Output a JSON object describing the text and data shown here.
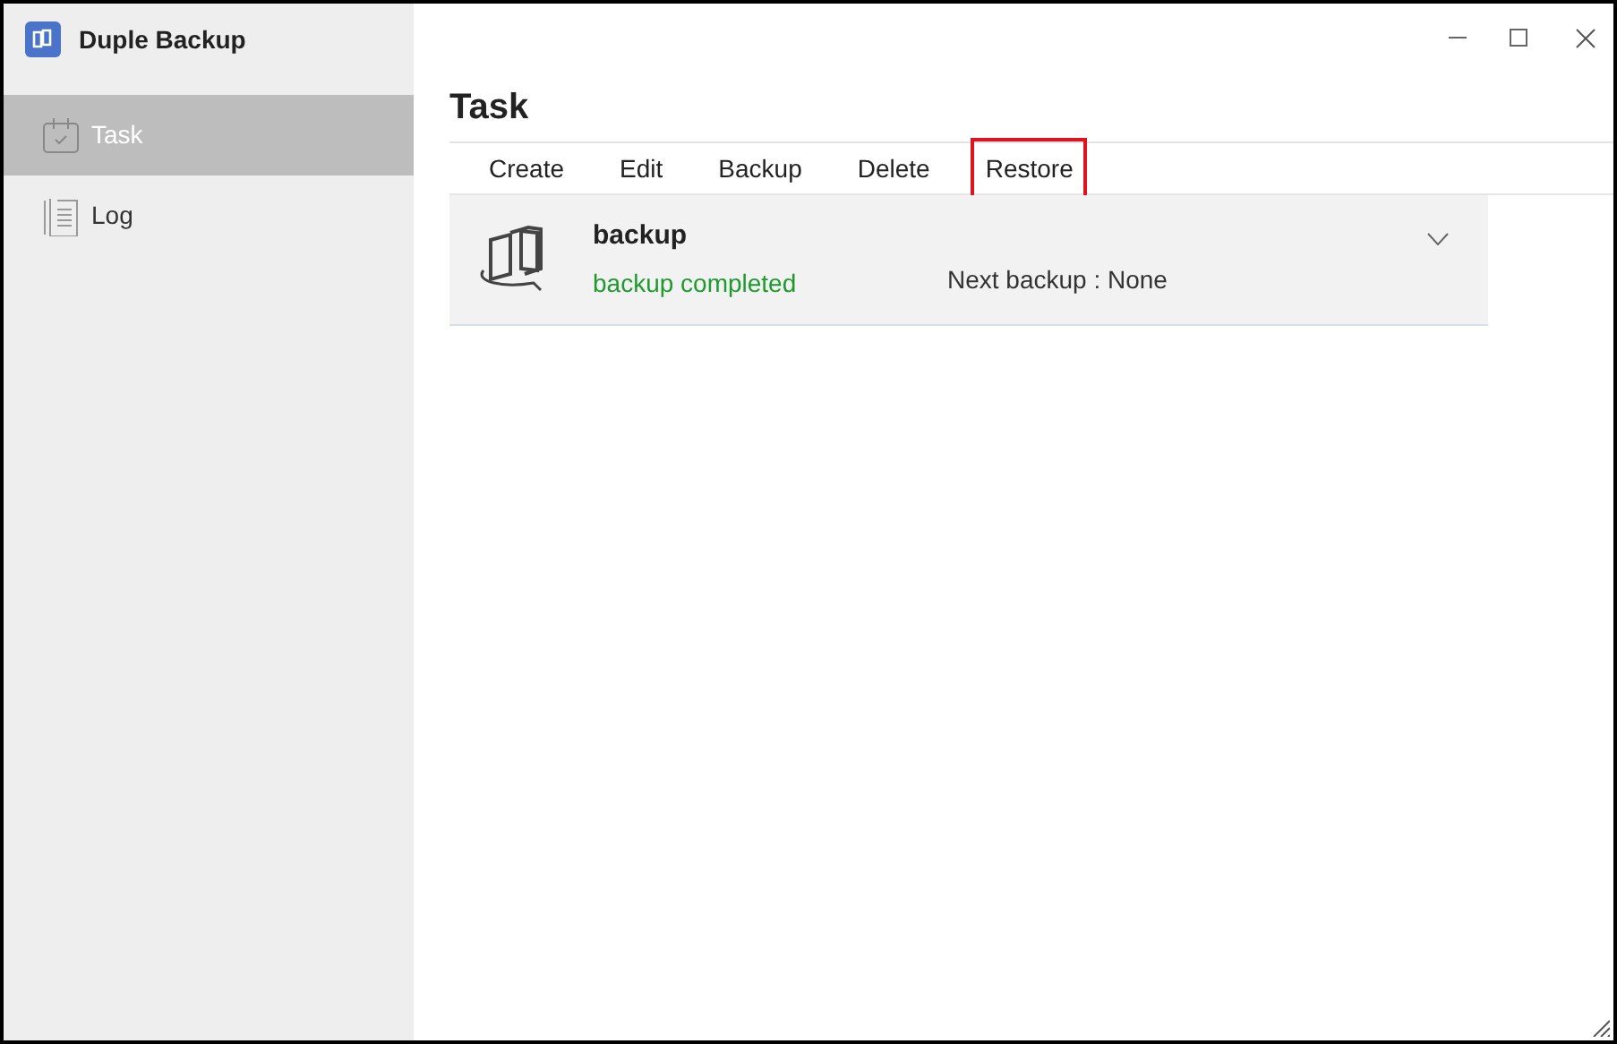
{
  "window": {
    "title": "Duple Backup"
  },
  "sidebar": {
    "items": [
      {
        "label": "Task",
        "selected": true
      },
      {
        "label": "Log",
        "selected": false
      }
    ]
  },
  "page": {
    "title": "Task"
  },
  "toolbar": [
    {
      "label": "Create",
      "highlighted": false
    },
    {
      "label": "Edit",
      "highlighted": false
    },
    {
      "label": "Backup",
      "highlighted": false
    },
    {
      "label": "Delete",
      "highlighted": false
    },
    {
      "label": "Restore",
      "highlighted": true
    }
  ],
  "tasks": [
    {
      "name": "backup",
      "status": "backup completed",
      "next": "Next backup : None",
      "expanded": false
    }
  ]
}
